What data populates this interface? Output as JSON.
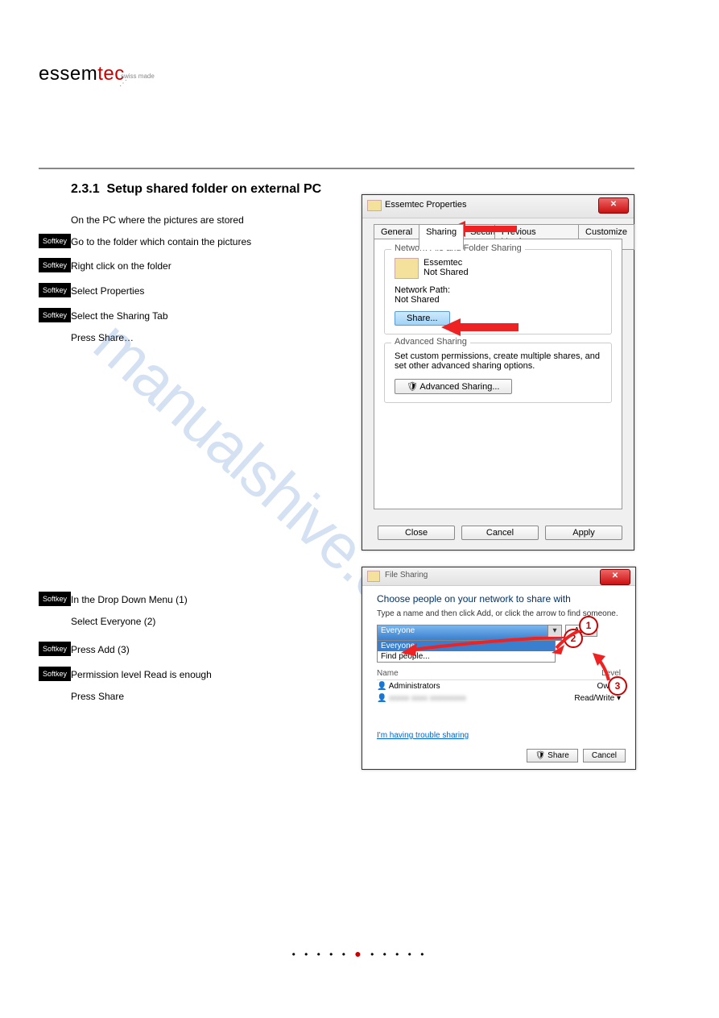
{
  "logo": {
    "black": "essem",
    "red": "tec",
    "sub": "swiss made"
  },
  "section": {
    "num": "2.3.1",
    "title": "Setup shared folder on external PC"
  },
  "soft": [
    "Softkey",
    "Softkey",
    "Softkey",
    "Softkey",
    "Softkey",
    "Softkey",
    "Softkey"
  ],
  "step1": [
    "On the PC where the pictures are stored",
    "Go to the folder which contain the pictures",
    "Right click on the folder",
    "Select Properties",
    "Select the Sharing Tab",
    "Press Share…"
  ],
  "step2": [
    "In the Drop Down Menu (1)",
    "Select Everyone (2)",
    "Press Add (3)",
    "Permission level Read is enough",
    "Press Share"
  ],
  "win1": {
    "title": "Essemtec Properties",
    "tabs": [
      "General",
      "Sharing",
      "Security",
      "Previous Versions",
      "Customize"
    ],
    "grp1_title": "Network File and Folder Sharing",
    "folder_name": "Essemtec",
    "folder_state": "Not Shared",
    "path_label": "Network Path:",
    "path_value": "Not Shared",
    "share_btn": "Share...",
    "grp2_title": "Advanced Sharing",
    "grp2_txt": "Set custom permissions, create multiple shares, and set other advanced sharing options.",
    "adv_btn": "Advanced Sharing...",
    "btn_close": "Close",
    "btn_cancel": "Cancel",
    "btn_apply": "Apply"
  },
  "win2": {
    "title": "File Sharing",
    "heading": "Choose people on your network to share with",
    "hint": "Type a name and then click Add, or click the arrow to find someone.",
    "combo_sel": "Everyone",
    "drop_items": [
      "Everyone",
      "Find people..."
    ],
    "add_btn": "Add",
    "col_name": "Name",
    "col_level": "Permission Level",
    "rows": [
      {
        "name": "Administrators",
        "level": "Owner"
      },
      {
        "name": "",
        "level": "Read/Write ▾"
      }
    ],
    "link": "I'm having trouble sharing",
    "btn_share": "Share",
    "btn_cancel": "Cancel"
  },
  "numbers": {
    "n1": "1",
    "n2": "2",
    "n3": "3"
  },
  "watermark": "manualshive.com"
}
